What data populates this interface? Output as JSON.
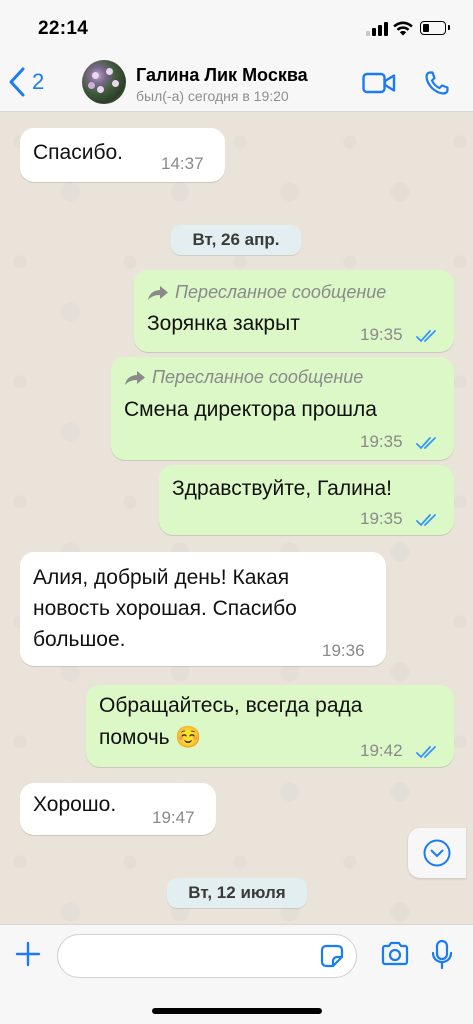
{
  "status_bar": {
    "time": "22:14"
  },
  "header": {
    "back_count": "2",
    "contact_name": "Галина Лик Москва",
    "contact_status": "был(-а) сегодня в 19:20"
  },
  "messages": [
    {
      "dir": "in",
      "text": "Спасибо.",
      "time": "14:37"
    },
    {
      "dir": "out",
      "forwarded": "Пересланное сообщение",
      "text": "Зорянка закрыт",
      "time": "19:35"
    },
    {
      "dir": "out",
      "forwarded": "Пересланное сообщение",
      "text": "Смена директора прошла",
      "time": "19:35"
    },
    {
      "dir": "out",
      "text": "Здравствуйте, Галина!",
      "time": "19:35"
    },
    {
      "dir": "in",
      "lines": [
        "Алия, добрый день! Какая",
        "новость хорошая. Спасибо",
        "большое."
      ],
      "time": "19:36"
    },
    {
      "dir": "out",
      "lines": [
        "Обращайтесь, всегда рада",
        "помочь ☺️"
      ],
      "time": "19:42"
    },
    {
      "dir": "in",
      "text": "Хорошо.",
      "time": "19:47"
    }
  ],
  "date_separators": [
    "Вт, 26 апр.",
    "Вт, 12 июля"
  ],
  "input": {
    "placeholder": ""
  },
  "colors": {
    "accent": "#1a7cf5",
    "outgoing_bubble": "#dcf8c6",
    "incoming_bubble": "#ffffff",
    "read_ticks": "#3497f9"
  },
  "icons": [
    "chevron-left-icon",
    "video-camera-icon",
    "phone-icon",
    "forward-arrow-icon",
    "double-check-icon",
    "chevron-down-icon",
    "plus-icon",
    "sticker-icon",
    "camera-icon",
    "microphone-icon"
  ]
}
